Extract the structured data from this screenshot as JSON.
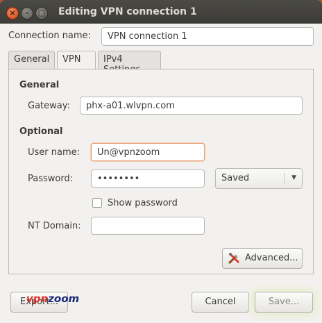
{
  "window": {
    "title": "Editing VPN connection 1"
  },
  "connection": {
    "label": "Connection name:",
    "value": "VPN connection 1"
  },
  "tabs": [
    {
      "label": "General"
    },
    {
      "label": "VPN"
    },
    {
      "label": "IPv4 Settings"
    }
  ],
  "general": {
    "heading": "General",
    "gateway_label": "Gateway:",
    "gateway_value": "phx-a01.wlvpn.com"
  },
  "optional": {
    "heading": "Optional",
    "username_label": "User name:",
    "username_value": "Un@vpnzoom",
    "password_label": "Password:",
    "password_value": "••••••••",
    "password_mode": "Saved",
    "show_password_label": "Show password",
    "show_password_checked": false,
    "nt_domain_label": "NT Domain:",
    "nt_domain_value": ""
  },
  "buttons": {
    "advanced": "Advanced...",
    "export": "Export...",
    "cancel": "Cancel",
    "save": "Save..."
  },
  "logo": {
    "prefix": "vpn",
    "suffix": "zoom"
  },
  "colors": {
    "titlebar": "#3c3b37",
    "close_button": "#e9622d",
    "focus_border": "#e8a079",
    "logo_primary": "#1b2a7a",
    "logo_accent": "#e0322c"
  }
}
